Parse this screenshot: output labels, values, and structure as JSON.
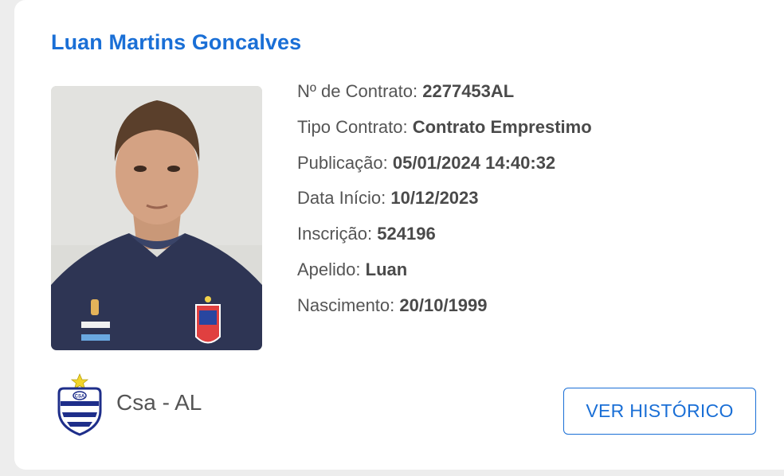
{
  "player": {
    "name": "Luan Martins Goncalves",
    "photo_icon": "player-photo"
  },
  "details": [
    {
      "label": "Nº de Contrato:",
      "value": "2277453AL"
    },
    {
      "label": "Tipo Contrato:",
      "value": "Contrato Emprestimo"
    },
    {
      "label": "Publicação:",
      "value": "05/01/2024 14:40:32"
    },
    {
      "label": "Data Início:",
      "value": "10/12/2023"
    },
    {
      "label": "Inscrição:",
      "value": "524196"
    },
    {
      "label": "Apelido:",
      "value": "Luan"
    },
    {
      "label": "Nascimento:",
      "value": "20/10/1999"
    }
  ],
  "club": {
    "name": "Csa - AL",
    "logo_icon": "csa-crest-icon"
  },
  "actions": {
    "history_label": "VER HISTÓRICO"
  },
  "colors": {
    "accent": "#1a6fd6",
    "text": "#555555",
    "card_bg": "#ffffff",
    "page_bg": "#ededed"
  }
}
